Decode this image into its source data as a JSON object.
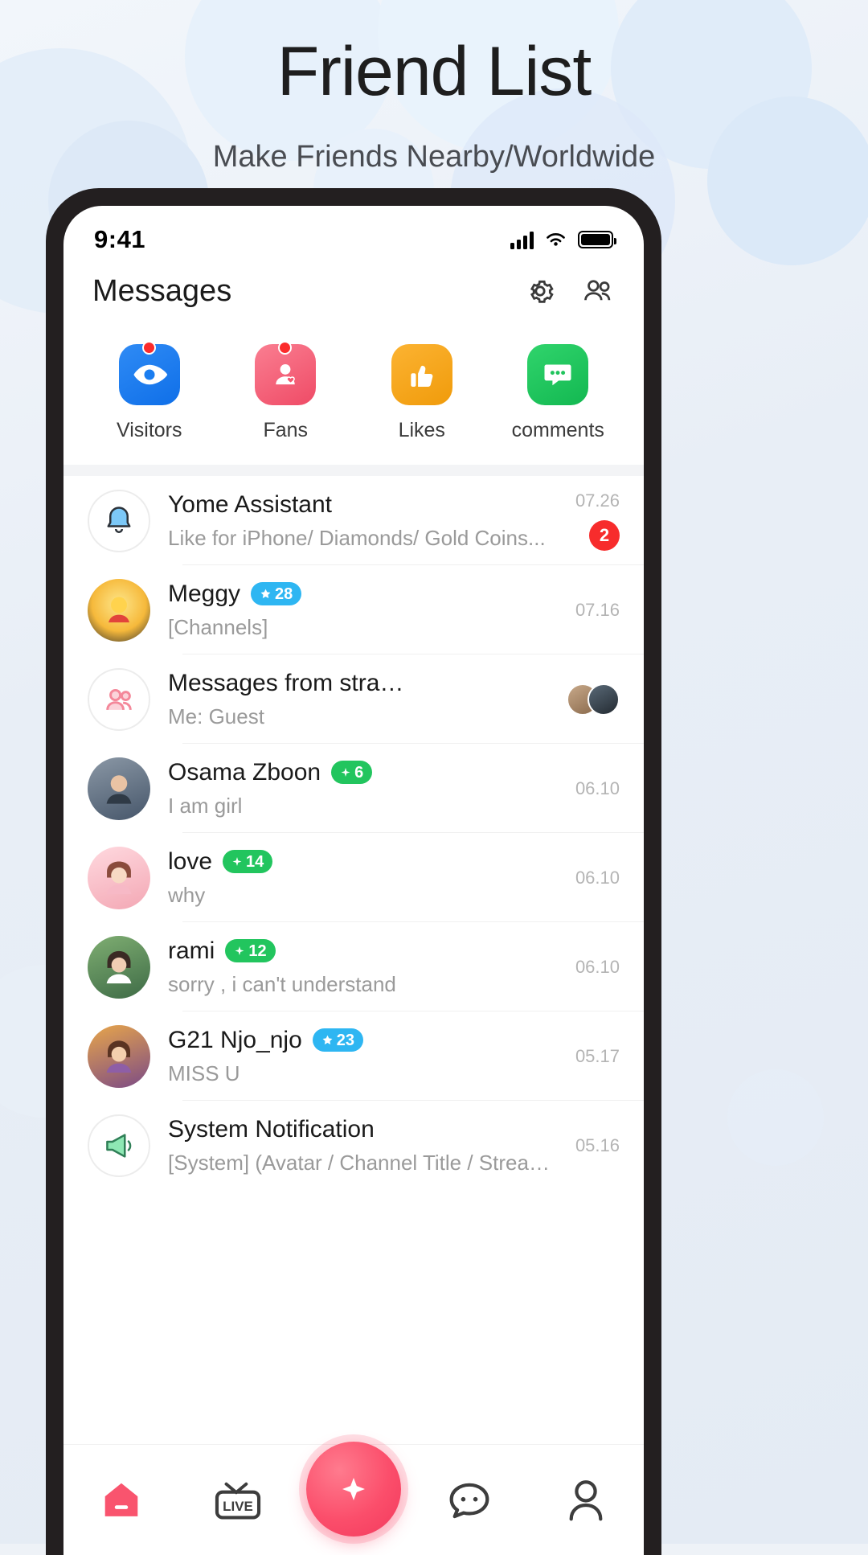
{
  "promo": {
    "title": "Friend List",
    "subtitle": "Make Friends Nearby/Worldwide"
  },
  "colors": {
    "accent_red": "#f72c2c",
    "badge_blue": "#2eb6f2",
    "badge_green": "#22c55e",
    "visitors_blue": "#1a7df0",
    "fans_pink": "#f4586f",
    "likes_yellow": "#f5a623",
    "comments_green": "#21c45d",
    "fab_pink": "#fb4e6b"
  },
  "status_bar": {
    "time": "9:41",
    "signal_icon": "cellular-signal-icon",
    "wifi_icon": "wifi-icon",
    "battery_icon": "battery-full-icon"
  },
  "header": {
    "title": "Messages",
    "actions": [
      {
        "name": "settings-icon",
        "label": "Settings"
      },
      {
        "name": "contacts-icon",
        "label": "Contacts"
      }
    ]
  },
  "quick_actions": [
    {
      "label": "Visitors",
      "icon": "eye-icon",
      "color": "#1a7df0",
      "dot": true
    },
    {
      "label": "Fans",
      "icon": "heart-user-icon",
      "color": "#f4586f",
      "dot": true
    },
    {
      "label": "Likes",
      "icon": "thumbs-up-icon",
      "color": "#f5a623",
      "dot": false
    },
    {
      "label": "comments",
      "icon": "comment-icon",
      "color": "#21c45d",
      "dot": false
    }
  ],
  "conversations": [
    {
      "name": "Yome Assistant",
      "preview": "Like for iPhone/ Diamonds/ Gold Coins...",
      "time": "07.26",
      "unread": "2",
      "badge": null,
      "avatar": "bell-icon"
    },
    {
      "name": "Meggy",
      "preview": "[Channels]",
      "time": "07.16",
      "unread": null,
      "badge": {
        "type": "level",
        "value": "28",
        "icon": "star-icon"
      },
      "avatar": "photo-avatar"
    },
    {
      "name": "Messages from stra…",
      "preview": "Me: Guest",
      "time": null,
      "unread": null,
      "badge": null,
      "avatar": "strangers-icon"
    },
    {
      "name": "Osama Zboon",
      "preview": "I am girl",
      "time": "06.10",
      "unread": null,
      "badge": {
        "type": "green",
        "value": "6",
        "icon": "spark-icon"
      },
      "avatar": "photo-avatar"
    },
    {
      "name": "love",
      "preview": "why",
      "time": "06.10",
      "unread": null,
      "badge": {
        "type": "green",
        "value": "14",
        "icon": "spark-icon"
      },
      "avatar": "photo-avatar"
    },
    {
      "name": "rami",
      "preview": "sorry , i can't understand",
      "time": "06.10",
      "unread": null,
      "badge": {
        "type": "green",
        "value": "12",
        "icon": "spark-icon"
      },
      "avatar": "photo-avatar"
    },
    {
      "name": "G21 Njo_njo",
      "preview": "MISS U",
      "time": "05.17",
      "unread": null,
      "badge": {
        "type": "level",
        "value": "23",
        "icon": "star-icon"
      },
      "avatar": "photo-avatar"
    },
    {
      "name": "System Notification",
      "preview": "[System] (Avatar / Channel Title / Stream Banner) Reset …",
      "time": "05.16",
      "unread": null,
      "badge": null,
      "avatar": "megaphone-icon"
    }
  ],
  "tabbar": [
    {
      "name": "home-icon",
      "label": "Home"
    },
    {
      "name": "live-icon",
      "label": "LIVE"
    },
    {
      "name": "create-icon",
      "label": "Create"
    },
    {
      "name": "messages-icon",
      "label": "Messages"
    },
    {
      "name": "profile-icon",
      "label": "Me"
    }
  ]
}
